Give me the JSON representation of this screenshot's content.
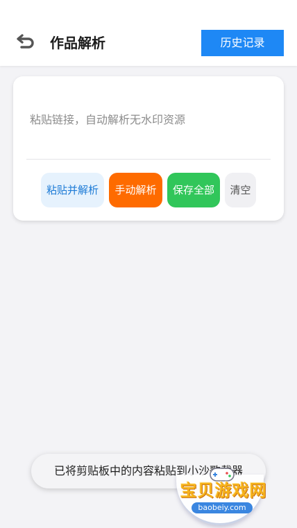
{
  "header": {
    "title": "作品解析",
    "history_label": "历史记录",
    "back_icon": "undo-back-arrow-icon"
  },
  "card": {
    "link_input": {
      "value": "",
      "placeholder": "粘贴链接，自动解析无水印资源"
    },
    "actions": {
      "paste_parse": "粘贴并解析",
      "manual_parse": "手动解析",
      "save_all": "保存全部",
      "clear": "清空"
    }
  },
  "toast": {
    "message": "已将剪贴板中的内容粘贴到小沙歌载器"
  },
  "watermark": {
    "logo_text": "宝贝游戏网",
    "url": "baobeiy.com",
    "icon": "gamepad-icon"
  },
  "colors": {
    "history_button": "#1e88f5",
    "paste_parse_bg": "#e6f2fd",
    "paste_parse_text": "#1d7bd6",
    "manual_parse_bg": "#fe6b00",
    "save_all_bg": "#31c65a",
    "clear_bg": "#f0f0f3",
    "page_bg": "#f3f3f6"
  }
}
